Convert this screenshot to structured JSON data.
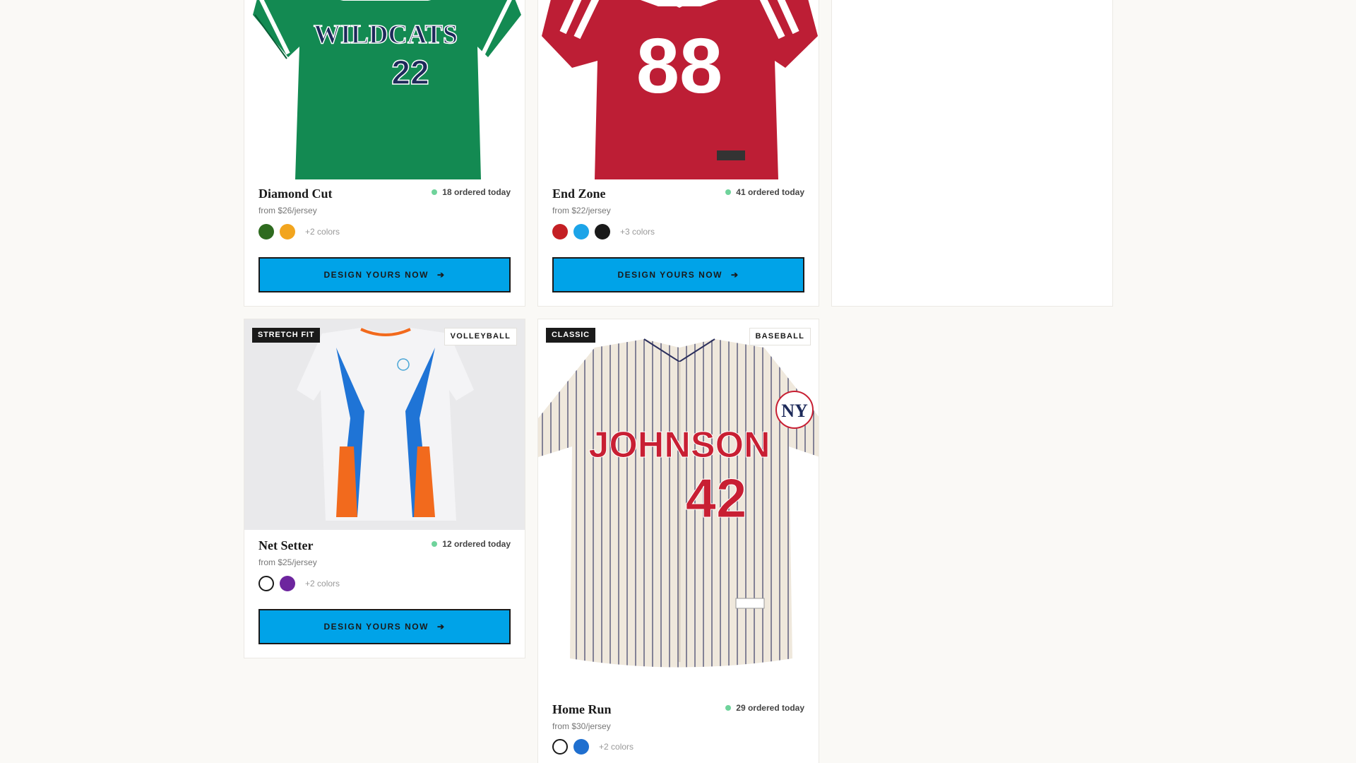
{
  "cards": [
    {
      "title": "Diamond Cut",
      "price": "from $26/jersey",
      "ordered": "18 ordered today",
      "swatches": [
        "#2e6b1f",
        "#f2a51e"
      ],
      "more": "+2 colors",
      "cta": "DESIGN YOURS NOW",
      "jersey_text": "WILDCATS",
      "jersey_number": "22"
    },
    {
      "title": "End Zone",
      "price": "from $22/jersey",
      "ordered": "41 ordered today",
      "swatches": [
        "#c41f24",
        "#1ca4e8",
        "#1a1a1a"
      ],
      "more": "+3 colors",
      "cta": "DESIGN YOURS NOW",
      "jersey_number": "88"
    },
    {
      "title": "Net Setter",
      "price": "from $25/jersey",
      "ordered": "12 ordered today",
      "tag": "STRETCH FIT",
      "category": "VOLLEYBALL",
      "swatches": [
        "#ffffff",
        "#6d259e"
      ],
      "more": "+2 colors",
      "cta": "DESIGN YOURS NOW"
    },
    {
      "title": "Home Run",
      "price": "from $30/jersey",
      "ordered": "29 ordered today",
      "tag": "CLASSIC",
      "category": "BASEBALL",
      "swatches": [
        "#ffffff",
        "#1f6fcf"
      ],
      "more": "+2 colors",
      "jersey_text": "JOHNSON",
      "jersey_number": "42"
    }
  ],
  "icons": {
    "arrow": "arrow-right-icon",
    "live": "live-dot-icon"
  }
}
